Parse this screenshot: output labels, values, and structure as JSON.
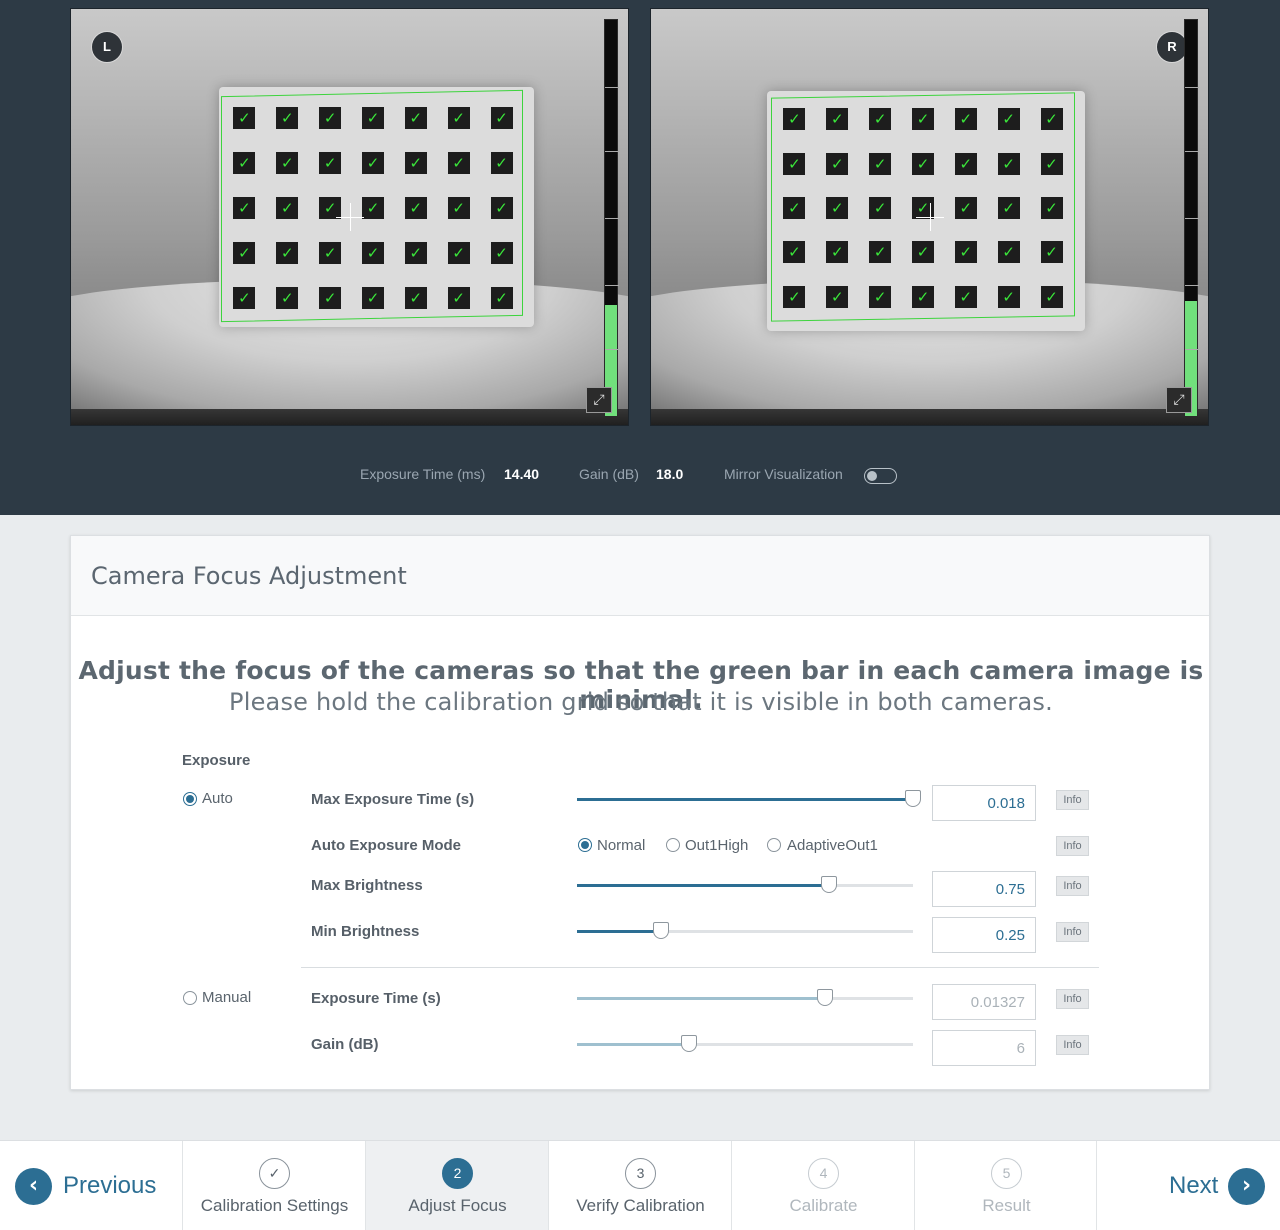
{
  "cameras": {
    "left": {
      "badge": "L",
      "focus_level": 0.28
    },
    "right": {
      "badge": "R",
      "focus_level": 0.29
    },
    "check_mark": "✓"
  },
  "stats": {
    "exposure_label": "Exposure Time (ms)",
    "exposure_value": "14.40",
    "gain_label": "Gain (dB)",
    "gain_value": "18.0",
    "mirror_label": "Mirror Visualization",
    "mirror_on": false
  },
  "panel": {
    "title": "Camera Focus Adjustment",
    "headline": "Adjust the focus of the cameras so that the green bar in each camera image is minimal.",
    "subline": "Please hold the calibration grid so that it is visible in both cameras.",
    "exposure_heading": "Exposure",
    "auto_label": "Auto",
    "manual_label": "Manual",
    "info_label": "Info",
    "auto": {
      "max_exposure": {
        "label": "Max Exposure Time (s)",
        "value": "0.018",
        "level": 1.0
      },
      "mode": {
        "label": "Auto Exposure Mode",
        "options": [
          "Normal",
          "Out1High",
          "AdaptiveOut1"
        ],
        "selected": "Normal"
      },
      "max_brightness": {
        "label": "Max Brightness",
        "value": "0.75",
        "level": 0.75
      },
      "min_brightness": {
        "label": "Min Brightness",
        "value": "0.25",
        "level": 0.25
      }
    },
    "manual": {
      "exposure": {
        "label": "Exposure Time (s)",
        "value": "0.01327",
        "level": 0.737
      },
      "gain": {
        "label": "Gain (dB)",
        "value": "6",
        "level": 0.333
      }
    },
    "selected_mode": "Auto"
  },
  "footer": {
    "previous": "Previous",
    "next": "Next",
    "steps": [
      {
        "number": "✓",
        "label": "Calibration Settings",
        "state": "done"
      },
      {
        "number": "2",
        "label": "Adjust Focus",
        "state": "active"
      },
      {
        "number": "3",
        "label": "Verify Calibration",
        "state": "pending"
      },
      {
        "number": "4",
        "label": "Calibrate",
        "state": "disabled"
      },
      {
        "number": "5",
        "label": "Result",
        "state": "disabled"
      }
    ]
  },
  "colors": {
    "accent": "#2c6e93",
    "focus_green": "#71e07c",
    "dark_bg": "#2d3a45"
  }
}
